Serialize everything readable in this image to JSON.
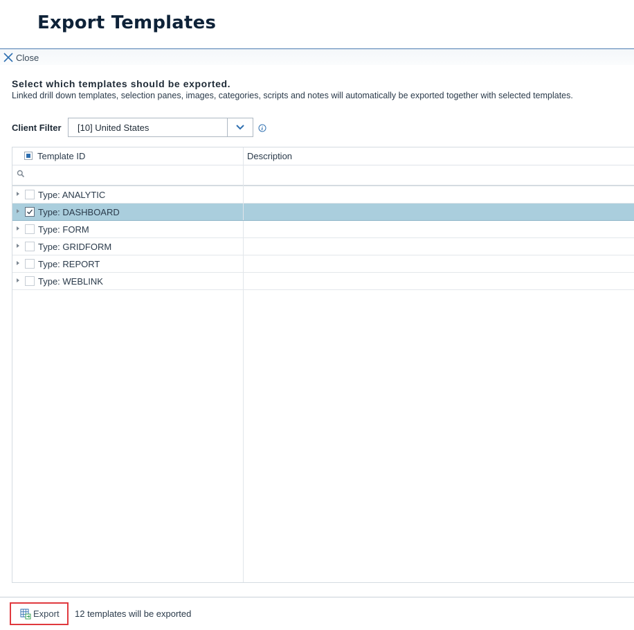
{
  "page": {
    "title": "Export Templates",
    "close_label": "Close",
    "heading": "Select which templates should be exported.",
    "subtext": "Linked drill down templates, selection panes, images, categories, scripts and notes will automatically be exported together with selected templates."
  },
  "filter": {
    "label": "Client Filter",
    "value": "[10] United States"
  },
  "grid": {
    "columns": {
      "template_id": "Template ID",
      "description": "Description"
    },
    "rows": [
      {
        "label": "Type: ANALYTIC",
        "checked": false,
        "selected": false
      },
      {
        "label": "Type: DASHBOARD",
        "checked": true,
        "selected": true
      },
      {
        "label": "Type: FORM",
        "checked": false,
        "selected": false
      },
      {
        "label": "Type: GRIDFORM",
        "checked": false,
        "selected": false
      },
      {
        "label": "Type: REPORT",
        "checked": false,
        "selected": false
      },
      {
        "label": "Type: WEBLINK",
        "checked": false,
        "selected": false
      }
    ]
  },
  "footer": {
    "export_label": "Export",
    "status": "12 templates will be exported"
  },
  "colors": {
    "accent": "#2e6fb0",
    "selected_row": "#aacedd",
    "export_highlight": "#e0393e"
  }
}
